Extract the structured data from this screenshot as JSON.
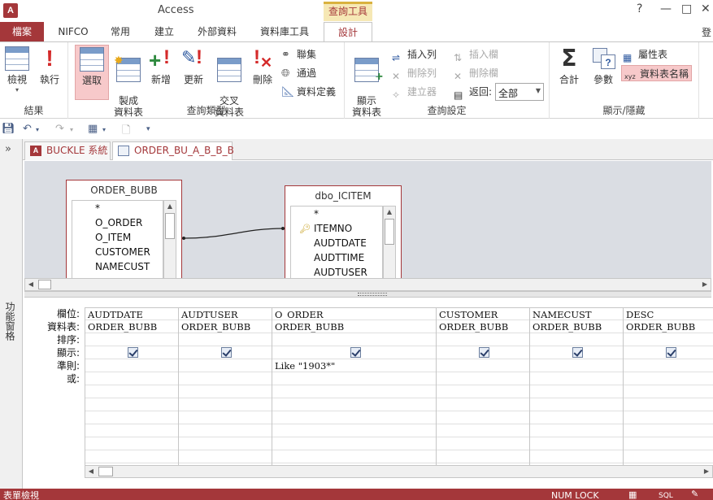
{
  "window": {
    "app_icon_letter": "A",
    "title": "Access",
    "context_tab_title": "查詢工具",
    "help": "?",
    "minimize": "—",
    "restore": "□",
    "close": "✕"
  },
  "tabs": [
    {
      "label": "檔案"
    },
    {
      "label": "NIFCO"
    },
    {
      "label": "常用"
    },
    {
      "label": "建立"
    },
    {
      "label": "外部資料"
    },
    {
      "label": "資料庫工具"
    },
    {
      "label": "設計"
    }
  ],
  "user_stub": "登",
  "ribbon": {
    "groups": {
      "results": "結果",
      "query_type": "查詢類型",
      "query_setup": "查詢設定",
      "show_hide": "顯示/隱藏"
    },
    "buttons": {
      "view": "檢視",
      "run": "執行",
      "select": "選取",
      "make_table": "製成\n資料表",
      "append": "新增",
      "update": "更新",
      "crosstab": "交叉\n資料表",
      "delete": "刪除",
      "union": "聯集",
      "pass_through": "通過",
      "data_definition": "資料定義",
      "show_table": "顯示\n資料表",
      "insert_rows": "插入列",
      "delete_rows": "刪除列",
      "builder": "建立器",
      "insert_columns": "插入欄",
      "delete_columns": "刪除欄",
      "return_label": "返回:",
      "return_value": "全部",
      "totals": "合計",
      "parameters": "參數",
      "property_sheet": "屬性表",
      "table_names": "資料表名稱"
    }
  },
  "nav_pane": {
    "toggle": "»",
    "label": "功能窗格"
  },
  "doc_tabs": [
    {
      "label": "BUCKLE 系統"
    },
    {
      "label": "ORDER_BU_A_B_B_B"
    }
  ],
  "tables": [
    {
      "title": "ORDER_BUBB",
      "fields": [
        "*",
        "O_ORDER",
        "O_ITEM",
        "CUSTOMER",
        "NAMECUST"
      ]
    },
    {
      "title": "dbo_ICITEM",
      "fields": [
        "*",
        "ITEMNO",
        "AUDTDATE",
        "AUDTTIME",
        "AUDTUSER"
      ]
    }
  ],
  "grid": {
    "row_labels": [
      "欄位:",
      "資料表:",
      "排序:",
      "顯示:",
      "準則:",
      "或:"
    ],
    "columns": [
      {
        "field": "AUDTDATE",
        "table": "ORDER_BUBB",
        "sort": "",
        "show": true,
        "criteria": "",
        "or": ""
      },
      {
        "field": "AUDTUSER",
        "table": "ORDER_BUBB",
        "sort": "",
        "show": true,
        "criteria": "",
        "or": ""
      },
      {
        "field": "O_ORDER",
        "table": "ORDER_BUBB",
        "sort": "",
        "show": true,
        "criteria": "Like \"1903*\"",
        "or": ""
      },
      {
        "field": "CUSTOMER",
        "table": "ORDER_BUBB",
        "sort": "",
        "show": true,
        "criteria": "",
        "or": ""
      },
      {
        "field": "NAMECUST",
        "table": "ORDER_BUBB",
        "sort": "",
        "show": true,
        "criteria": "",
        "or": ""
      },
      {
        "field": "DESC",
        "table": "ORDER_BUBB",
        "sort": "",
        "show": true,
        "criteria": "",
        "or": ""
      }
    ]
  },
  "status": {
    "left": "表單檢視",
    "numlock": "NUM LOCK",
    "sql": "SQL"
  },
  "colors": {
    "accent": "#a4373a",
    "active_button": "#f7c9ca",
    "context_tab": "#f6e8b5"
  }
}
